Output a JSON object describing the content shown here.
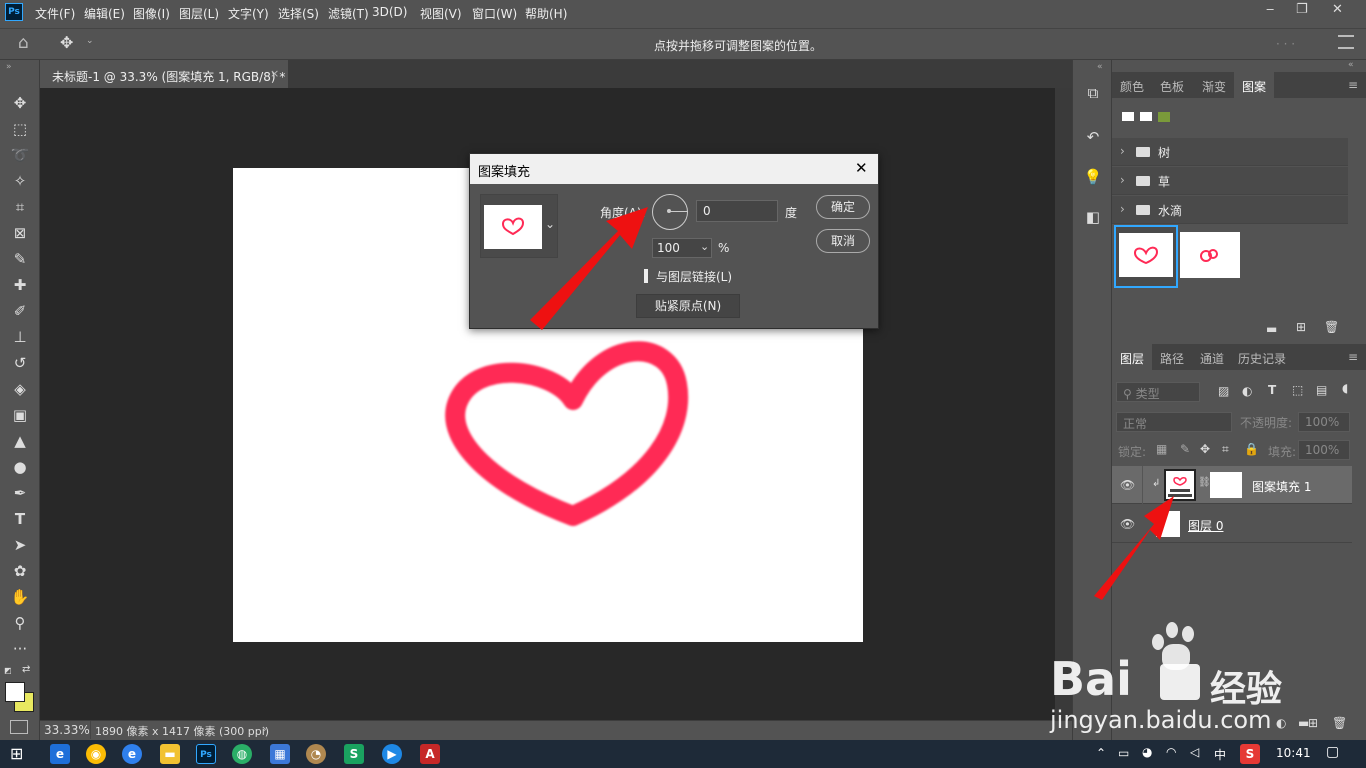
{
  "app": {
    "logo": "Ps"
  },
  "menu": [
    "文件(F)",
    "编辑(E)",
    "图像(I)",
    "图层(L)",
    "文字(Y)",
    "选择(S)",
    "滤镜(T)",
    "3D(D)",
    "视图(V)",
    "窗口(W)",
    "帮助(H)"
  ],
  "options_bar": {
    "hint": "点按并拖移可调整图案的位置。"
  },
  "document_tab": {
    "title": "未标题-1 @ 33.3% (图案填充 1, RGB/8) *",
    "close": "×"
  },
  "status": {
    "zoom": "33.33%",
    "info": "1890 像素 x 1417 像素 (300 ppi)"
  },
  "dialog": {
    "title": "图案填充",
    "angle_label": "角度(A):",
    "angle_value": "0",
    "angle_unit": "度",
    "scale_value": "100",
    "scale_unit": "%",
    "link_label": "与图层链接(L)",
    "snap_button": "贴紧原点(N)",
    "ok_button": "确定",
    "cancel_button": "取消"
  },
  "patterns_panel": {
    "tabs": [
      "颜色",
      "色板",
      "渐变",
      "图案"
    ],
    "active_tab": "图案",
    "folders": [
      "树",
      "草",
      "水滴"
    ]
  },
  "layers_panel": {
    "tabs": [
      "图层",
      "路径",
      "通道",
      "历史记录"
    ],
    "active_tab": "图层",
    "filter_placeholder": "类型",
    "blend_mode": "正常",
    "opacity_label": "不透明度:",
    "opacity_value": "100%",
    "lock_label": "锁定:",
    "fill_label": "填充:",
    "fill_value": "100%",
    "layers": [
      {
        "name": "图案填充 1"
      },
      {
        "name": "图层 0"
      }
    ]
  },
  "taskbar": {
    "ime": "中",
    "time": "10:41"
  },
  "watermark": {
    "brand": "Bai",
    "brand2": "经验",
    "url": "jingyan.baidu.com"
  },
  "colors": {
    "heart": "#ff2a55",
    "arrow": "#ee1111",
    "selection": "#31a8ff"
  }
}
